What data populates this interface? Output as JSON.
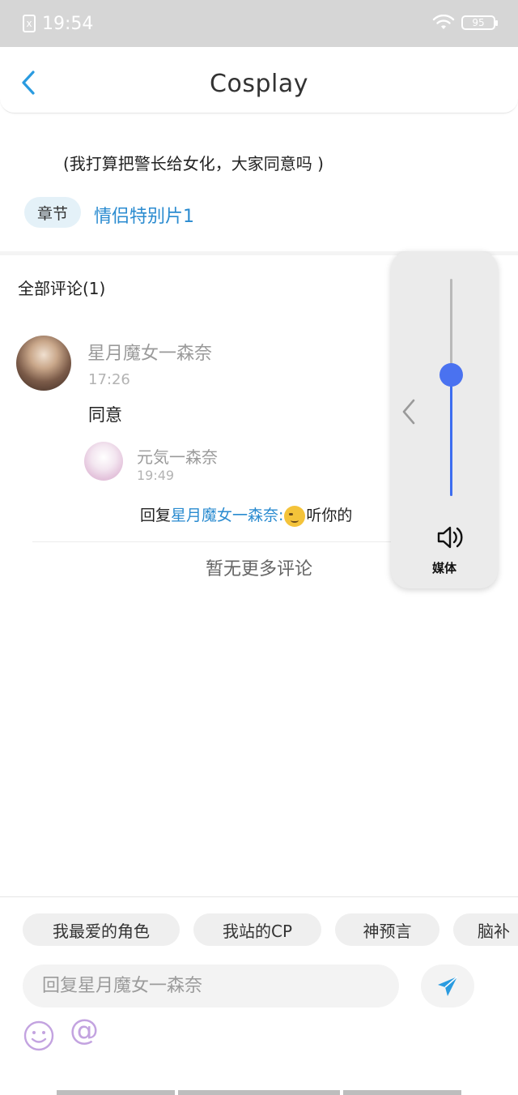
{
  "status_bar": {
    "sim_icon": "x",
    "time": "19:54",
    "battery": "95",
    "wifi_icon": "wifi-icon"
  },
  "header": {
    "title": "Cosplay",
    "back_icon": "chevron-left-icon"
  },
  "post": {
    "text": "(我打算把警长给女化，大家同意吗 )",
    "chapter_label": "章节",
    "chapter_link": "情侣特别片1"
  },
  "comments": {
    "header": "全部评论(1)",
    "items": [
      {
        "user": "星月魔女一森奈",
        "time": "17:26",
        "text": "同意",
        "replies": [
          {
            "user": "元気一森奈",
            "time": "19:49",
            "prefix": "回复",
            "target": "星月魔女一森奈:",
            "suffix": "听你的"
          }
        ]
      }
    ],
    "no_more": "暂无更多评论"
  },
  "volume_overlay": {
    "label": "媒体",
    "level_percent": 56,
    "accent_color": "#3d6df0"
  },
  "bottom": {
    "tags": [
      "我最爱的角色",
      "我站的CP",
      "神预言",
      "脑补"
    ],
    "input_placeholder": "回复星月魔女一森奈",
    "mention_symbol": "@",
    "send_icon": "send-icon",
    "emoji_icon": "smiley-icon"
  }
}
